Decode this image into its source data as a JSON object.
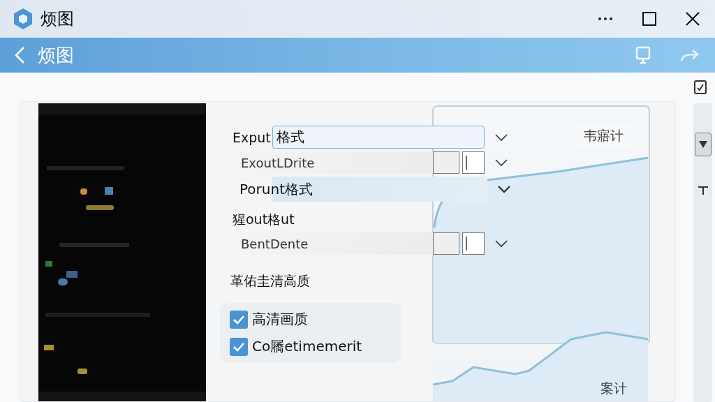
{
  "window": {
    "title": "烦图"
  },
  "header": {
    "title": "烦图"
  },
  "form": {
    "rows": [
      {
        "kind": "input",
        "label": "Exput",
        "value": "格式"
      },
      {
        "kind": "stepper",
        "label": "ExoutLDrite"
      },
      {
        "kind": "highlight",
        "label": "Porunt格式"
      },
      {
        "kind": "heading",
        "label": "猩out格ut"
      },
      {
        "kind": "stepper",
        "label": "BentDente"
      },
      {
        "kind": "heading",
        "label": "革佑圭清高质"
      }
    ],
    "checkboxes": [
      {
        "label": "高清画质",
        "checked": true
      },
      {
        "label": "Co屩etimemerit",
        "checked": true
      }
    ]
  },
  "chart": {
    "top_label": "韦寤计",
    "bottom_label": "案计"
  }
}
